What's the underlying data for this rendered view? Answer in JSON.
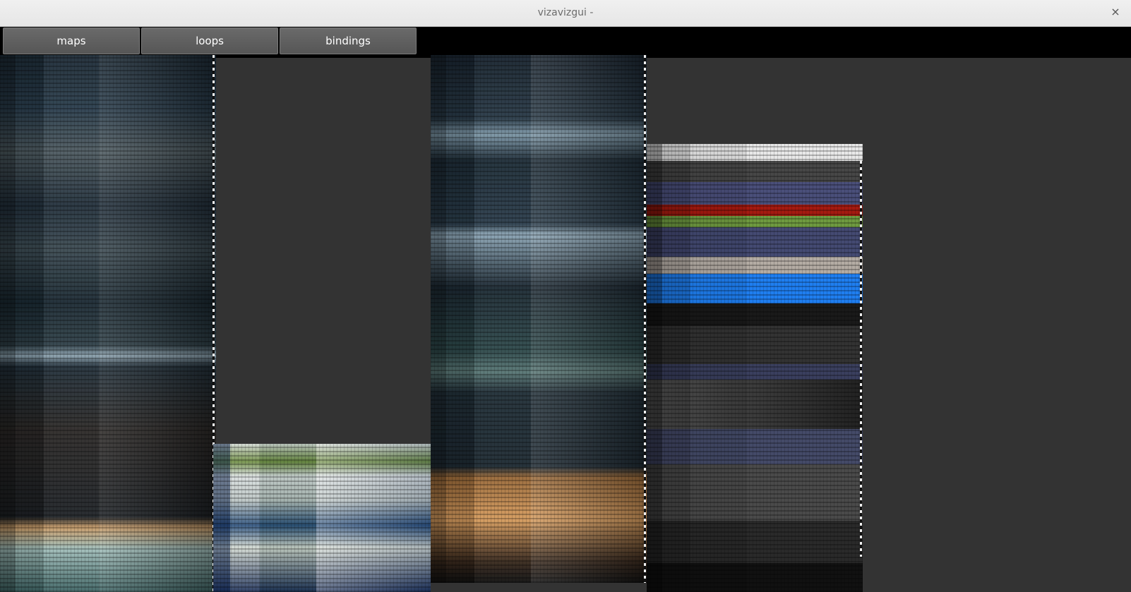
{
  "window": {
    "title": "vizavizgui -",
    "close_symbol": "×"
  },
  "tabs": [
    {
      "label": "maps"
    },
    {
      "label": "loops"
    },
    {
      "label": "bindings"
    }
  ],
  "colors": {
    "tab_bg": "#5f5f5f",
    "canvas_bg": "#333333",
    "titlebar_bg": "#ececec"
  }
}
